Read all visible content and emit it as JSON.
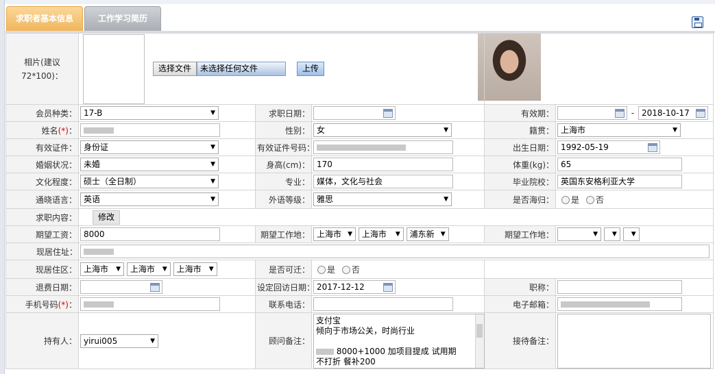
{
  "tabs": [
    {
      "label": "求职者基本信息",
      "active": true
    },
    {
      "label": "工作学习简历",
      "active": false
    }
  ],
  "photo": {
    "label": "相片(建议72*100)：",
    "choose_file_label": "选择文件",
    "no_file_text": "未选择任何文件",
    "upload_label": "上传"
  },
  "fields": {
    "member_type": {
      "label": "会员种类：",
      "value": "17-B"
    },
    "job_date": {
      "label": "求职日期：",
      "value": ""
    },
    "validity": {
      "label": "有效期：",
      "from": "",
      "sep": "-",
      "to": "2018-10-17"
    },
    "name": {
      "label": "姓名",
      "req": "(*)",
      "colon": "："
    },
    "gender": {
      "label": "性别：",
      "value": "女"
    },
    "native": {
      "label": "籍贯：",
      "value": "上海市"
    },
    "id_type": {
      "label": "有效证件：",
      "value": "身份证"
    },
    "id_no": {
      "label": "有效证件号码："
    },
    "birth": {
      "label": "出生日期：",
      "value": "1992-05-19"
    },
    "marital": {
      "label": "婚姻状况：",
      "value": "未婚"
    },
    "height": {
      "label": "身高(cm)：",
      "value": "170"
    },
    "weight": {
      "label": "体重(kg)：",
      "value": "65"
    },
    "education": {
      "label": "文化程度：",
      "value": "硕士（全日制）"
    },
    "major": {
      "label": "专业：",
      "value": "媒体，文化与社会"
    },
    "school": {
      "label": "毕业院校：",
      "value": "英国东安格利亚大学"
    },
    "language": {
      "label": "通晓语言：",
      "value": "英语"
    },
    "lang_level": {
      "label": "外语等级：",
      "value": "雅思"
    },
    "returnee": {
      "label": "是否海归：",
      "yes": "是",
      "no": "否"
    },
    "job_content": {
      "label": "求职内容：",
      "button": "修改"
    },
    "salary": {
      "label": "期望工资：",
      "value": "8000"
    },
    "work_loc1": {
      "label": "期望工作地：",
      "v1": "上海市",
      "v2": "上海市",
      "v3": "浦东新"
    },
    "work_loc2": {
      "label": "期望工作地："
    },
    "address": {
      "label": "现居住址："
    },
    "district": {
      "label": "现居住区：",
      "v1": "上海市",
      "v2": "上海市",
      "v3": "上海市"
    },
    "relocate": {
      "label": "是否可迁：",
      "yes": "是",
      "no": "否"
    },
    "refund_date": {
      "label": "退费日期：",
      "value": ""
    },
    "revisit": {
      "label": "设定回访日期：",
      "value": "2017-12-12"
    },
    "title": {
      "label": "职称：",
      "value": ""
    },
    "mobile": {
      "label": "手机号码",
      "req": "(*)",
      "colon": "："
    },
    "phone": {
      "label": "联系电话：",
      "value": ""
    },
    "email": {
      "label": "电子邮箱："
    },
    "holder": {
      "label": "持有人：",
      "value": "yirui005"
    },
    "advisor_note": {
      "label": "顾问备注：",
      "lines": [
        "支付宝",
        "倾向于市场公关，时尚行业",
        "",
        "8000+1000 加项目提成 试用期",
        "不打折 餐补200"
      ]
    },
    "reception_note": {
      "label": "接待备注：",
      "value": ""
    }
  },
  "colors": {
    "tab_active": "#f1b55a",
    "tab_inactive": "#a9adb3",
    "label_bg": "#f3f3f3",
    "required": "#dd0000"
  }
}
